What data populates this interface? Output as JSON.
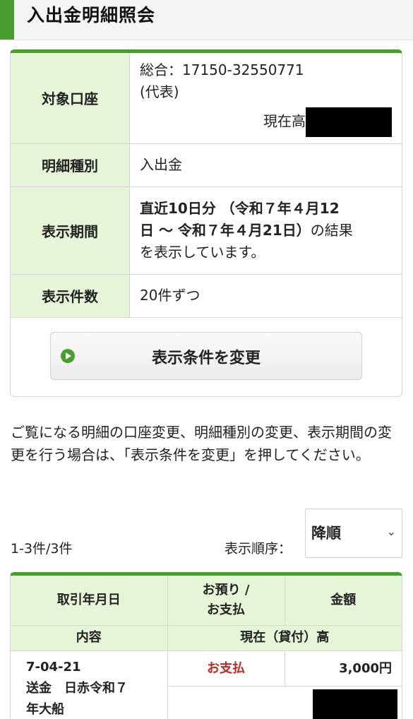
{
  "page_title": "入出金明細照会",
  "info": {
    "account_label": "対象口座",
    "account_value": "総合：17150-32550771",
    "account_rep": "(代表)",
    "balance_label": "現在高",
    "kind_label": "明細種別",
    "kind_value": "入出金",
    "period_label": "表示期間",
    "period_bold_1": "直近10日分 （令和７年４月12",
    "period_bold_2": "日 ～ 令和７年４月21日）",
    "period_rest_1": "の結果",
    "period_rest_2": "を表示しています。",
    "count_label": "表示件数",
    "count_value": "20件ずつ"
  },
  "change_button": "表示条件を変更",
  "note": "ご覧になる明細の口座変更、明細種別の変更、表示期間の変更を行う場合は、「表示条件を変更」を押してください。",
  "results": {
    "range": "1-3件/3件",
    "sort_label": "表示順序：",
    "sort_value": "降順",
    "headers": {
      "date": "取引年月日",
      "type_1": "お預り /",
      "type_2": "お支払",
      "amount": "金額",
      "content": "内容",
      "balance": "現在（貸付）高"
    },
    "rows": [
      {
        "date": "7-04-21",
        "type": "お支払",
        "amount": "3,000円",
        "desc_1": "送金　日赤令和７",
        "desc_2": "年大船"
      }
    ]
  },
  "colors": {
    "accent": "#4a9d2f",
    "header_bg": "#e6f4d7",
    "withdraw": "#c8261d"
  }
}
